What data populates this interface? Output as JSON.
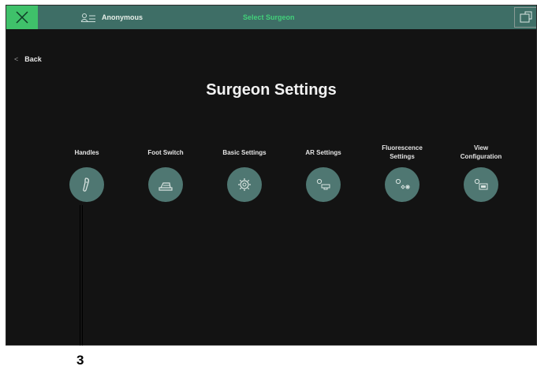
{
  "header": {
    "user_name": "Anonymous",
    "select_surgeon_label": "Select Surgeon",
    "icons": {
      "close": "close-icon",
      "user": "user-icon",
      "menu": "menu-icon"
    }
  },
  "nav": {
    "back_label": "Back"
  },
  "page": {
    "title": "Surgeon Settings"
  },
  "settings_items": [
    {
      "label": "Handles",
      "icon": "handle-icon"
    },
    {
      "label": "Foot Switch",
      "icon": "foot-switch-icon"
    },
    {
      "label": "Basic Settings",
      "icon": "gear-icon"
    },
    {
      "label": "AR Settings",
      "icon": "ar-settings-icon"
    },
    {
      "label": "Fluorescence\nSettings",
      "icon": "fluorescence-icon"
    },
    {
      "label": "View\nConfiguration",
      "icon": "view-configuration-icon"
    }
  ],
  "callout": {
    "number": "3"
  },
  "colors": {
    "header_bg": "#3e6e66",
    "close_bg": "#3fc16a",
    "accent": "#42d07a",
    "screen_bg": "#131313",
    "button_bg": "#4f7772"
  }
}
